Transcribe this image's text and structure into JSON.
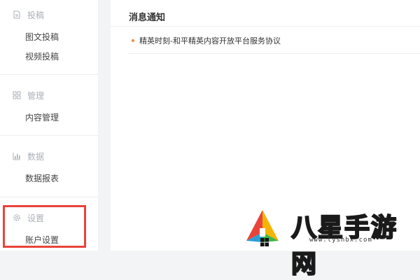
{
  "sidebar": {
    "sections": [
      {
        "title": "投稿",
        "icon": "document-icon",
        "items": [
          "图文投稿",
          "视频投稿"
        ]
      },
      {
        "title": "管理",
        "icon": "grid-icon",
        "items": [
          "内容管理"
        ]
      },
      {
        "title": "数据",
        "icon": "bar-chart-icon",
        "items": [
          "数据报表"
        ]
      },
      {
        "title": "设置",
        "icon": "gear-icon",
        "items": [
          "账户设置"
        ]
      }
    ]
  },
  "main": {
    "title": "消息通知",
    "notices": [
      "精英时刻-和平精英内容开放平台服务协议"
    ]
  },
  "watermark": {
    "brand": "八星手游网",
    "url": "www.lyshbx.com"
  },
  "colors": {
    "highlight_border": "#e8443b",
    "notice_bullet": "#f08a3a",
    "section_header": "#aab0b8"
  }
}
